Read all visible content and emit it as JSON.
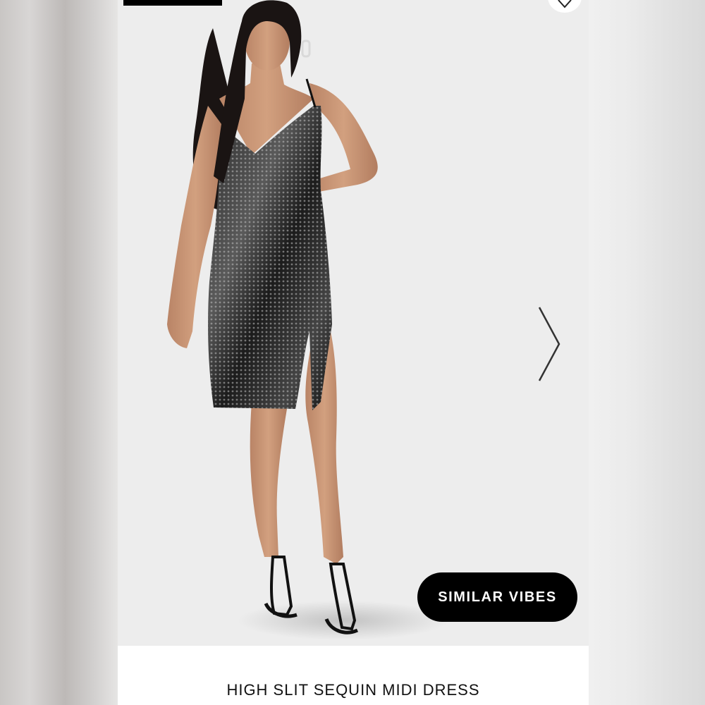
{
  "product": {
    "title": "HIGH SLIT SEQUIN MIDI DRESS",
    "image_alt": "model wearing black sequin dress with high slit"
  },
  "actions": {
    "similar_label": "SIMILAR VIBES"
  },
  "icons": {
    "wishlist": "heart-icon",
    "next": "chevron-right-icon"
  },
  "colors": {
    "button_background": "#000000",
    "button_text": "#ffffff",
    "image_background": "#ededed",
    "title_text": "#111111"
  }
}
